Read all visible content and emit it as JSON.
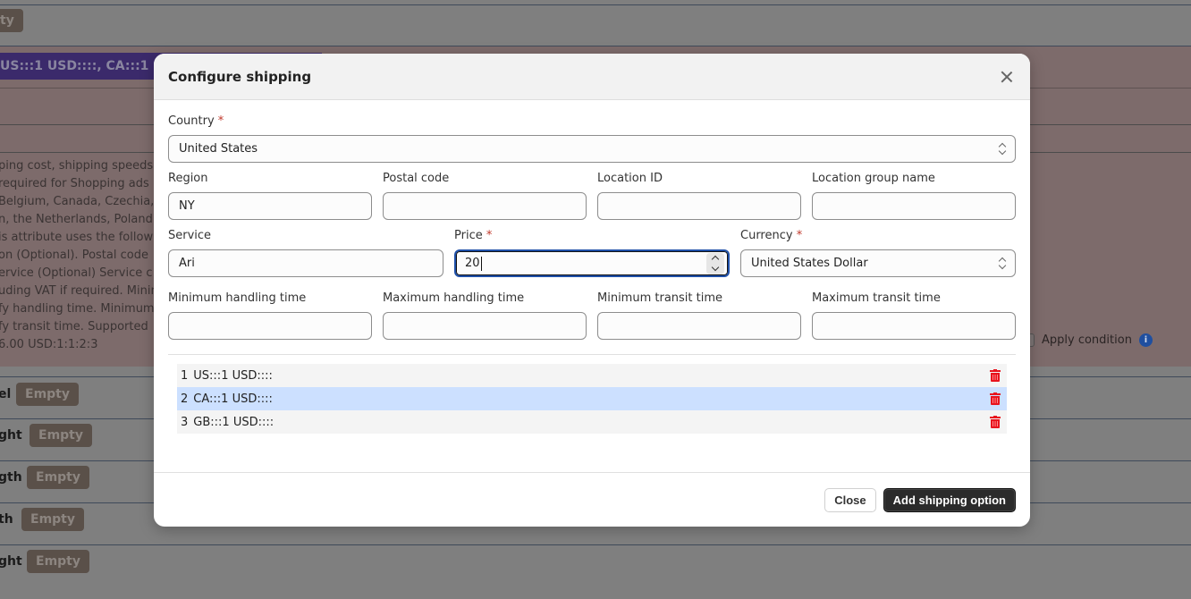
{
  "background": {
    "top_pill": "ty",
    "shipping_summary": "US:::1 USD::::, CA:::1",
    "description_lines": [
      "ping cost, shipping speeds",
      "required for Shopping ads",
      "Belgium, Canada, Czechia,",
      "n, the Netherlands, Poland",
      "is attribute uses the follow",
      "on (Optional). Postal code",
      "ervice (Optional) Service c",
      "uding VAT if required. Minin",
      "fy handling time. Minimum",
      "fy transit time. Supported",
      "6.00 USD:1:1:2:3"
    ],
    "apply_condition_label": "Apply condition",
    "info_glyph": "i",
    "attribute_rows": [
      {
        "label": "el",
        "value": "Empty"
      },
      {
        "label": "ght",
        "value": "Empty"
      },
      {
        "label": "gth",
        "value": "Empty"
      },
      {
        "label": "th",
        "value": "Empty"
      },
      {
        "label": "ght",
        "value": "Empty"
      }
    ]
  },
  "modal": {
    "title": "Configure shipping",
    "required_mark": "*",
    "fields": {
      "country": {
        "label": "Country",
        "value": "United States",
        "required": true
      },
      "region": {
        "label": "Region",
        "value": "NY"
      },
      "postal_code": {
        "label": "Postal code",
        "value": ""
      },
      "location_id": {
        "label": "Location ID",
        "value": ""
      },
      "location_group_name": {
        "label": "Location group name",
        "value": ""
      },
      "service": {
        "label": "Service",
        "value": "Ari"
      },
      "price": {
        "label": "Price",
        "value": "20",
        "required": true
      },
      "currency": {
        "label": "Currency",
        "value": "United States Dollar",
        "required": true
      },
      "min_handling_time": {
        "label": "Minimum handling time",
        "value": ""
      },
      "max_handling_time": {
        "label": "Maximum handling time",
        "value": ""
      },
      "min_transit_time": {
        "label": "Minimum transit time",
        "value": ""
      },
      "max_transit_time": {
        "label": "Maximum transit time",
        "value": ""
      }
    },
    "shipping_options": [
      {
        "index": "1",
        "value": "US:::1 USD::::",
        "selected": false
      },
      {
        "index": "2",
        "value": "CA:::1 USD::::",
        "selected": true
      },
      {
        "index": "3",
        "value": "GB:::1 USD::::",
        "selected": false
      }
    ],
    "footer": {
      "close_label": "Close",
      "add_label": "Add shipping option"
    }
  },
  "colors": {
    "accent_focus": "#1e4fa8",
    "delete_icon": "#e8141e",
    "selected_row": "#cce0ff",
    "primary_button": "#2b2b2b"
  }
}
